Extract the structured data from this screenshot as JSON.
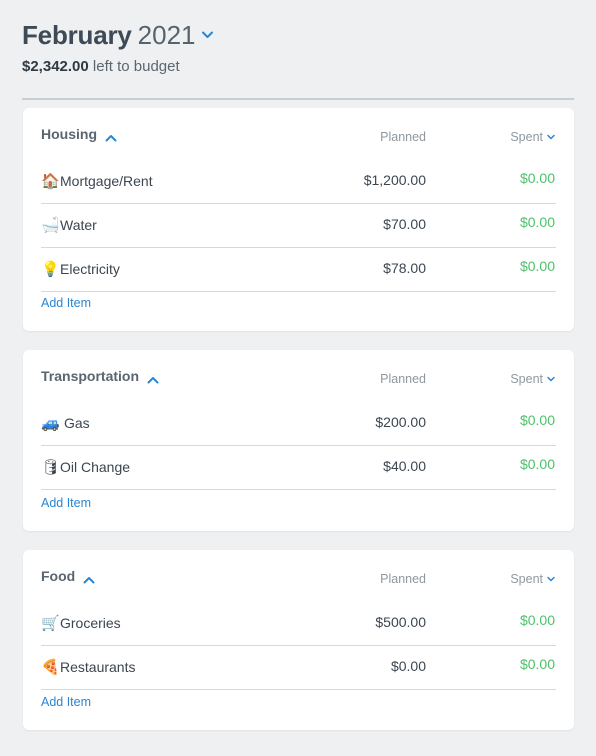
{
  "header": {
    "month": "February",
    "year": "2021",
    "left_amount": "$2,342.00",
    "left_label": "left to budget"
  },
  "columns": {
    "planned": "Planned",
    "spent": "Spent"
  },
  "colors": {
    "spent_green": "#4cc26a",
    "link_blue": "#2a86d4",
    "chevron_blue": "#2a86d4"
  },
  "groups": [
    {
      "title": "Housing",
      "add_label": "Add Item",
      "items": [
        {
          "icon": "house-icon",
          "glyph": "🏠",
          "name": "Mortgage/Rent",
          "planned": "$1,200.00",
          "spent": "$0.00"
        },
        {
          "icon": "bathtub-icon",
          "glyph": "🛁",
          "name": "Water",
          "planned": "$70.00",
          "spent": "$0.00"
        },
        {
          "icon": "lightbulb-icon",
          "glyph": "💡",
          "name": "Electricity",
          "planned": "$78.00",
          "spent": "$0.00"
        }
      ]
    },
    {
      "title": "Transportation",
      "add_label": "Add Item",
      "items": [
        {
          "icon": "car-icon",
          "glyph": "🚙",
          "name": "Gas",
          "planned": "$200.00",
          "spent": "$0.00"
        },
        {
          "icon": "oil-drum-icon",
          "glyph": "🛢",
          "name": "Oil Change",
          "planned": "$40.00",
          "spent": "$0.00"
        }
      ]
    },
    {
      "title": "Food",
      "add_label": "Add Item",
      "items": [
        {
          "icon": "shopping-cart-icon",
          "glyph": "🛒",
          "name": "Groceries",
          "planned": "$500.00",
          "spent": "$0.00"
        },
        {
          "icon": "pizza-icon",
          "glyph": "🍕",
          "name": "Restaurants",
          "planned": "$0.00",
          "spent": "$0.00"
        }
      ]
    }
  ]
}
